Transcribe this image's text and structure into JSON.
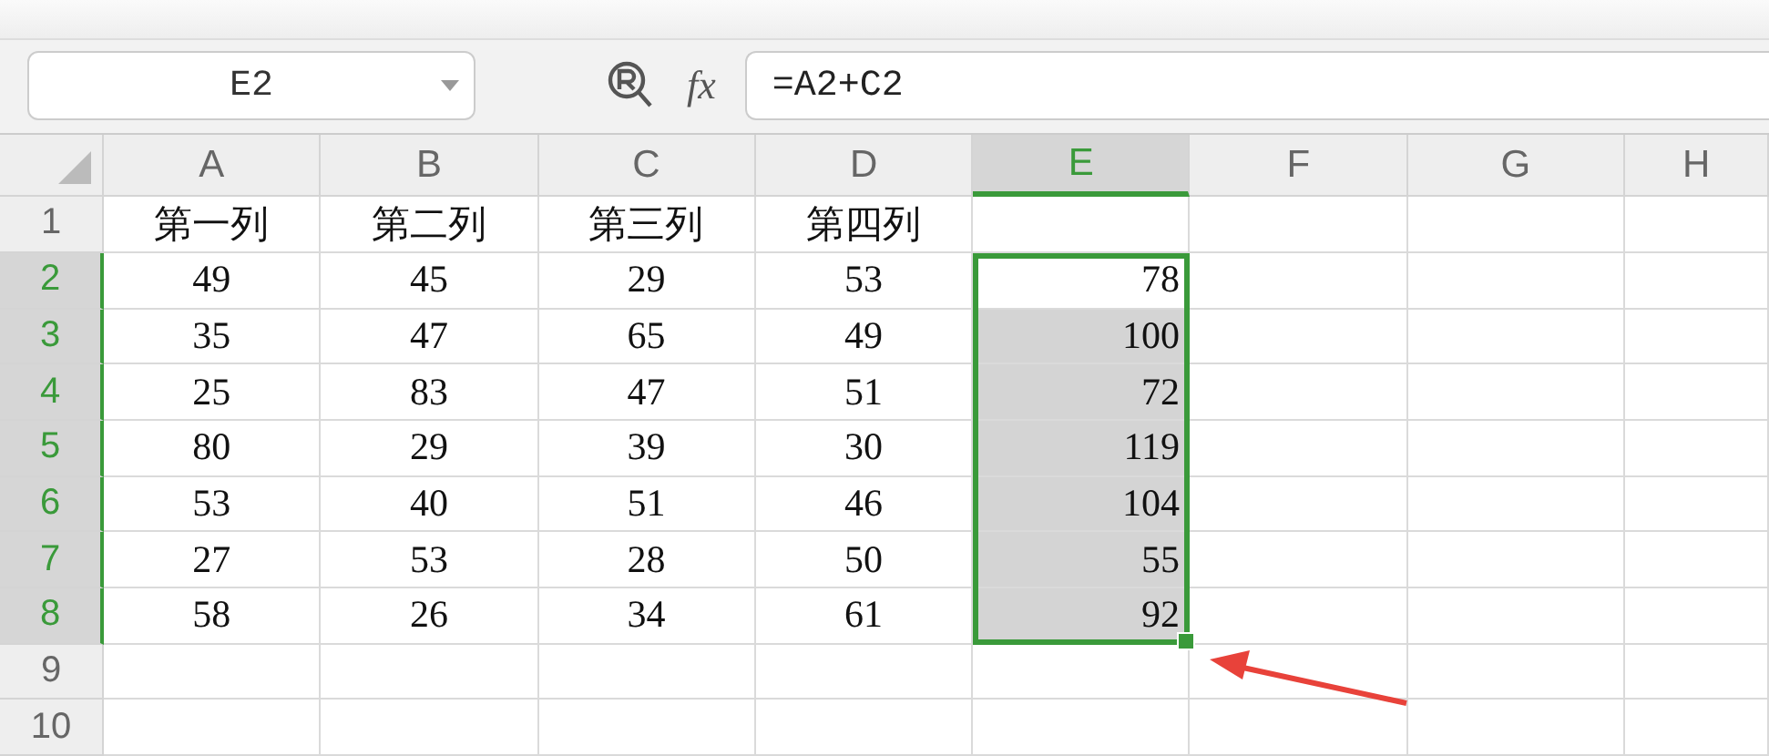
{
  "name_box": {
    "value": "E2"
  },
  "formula_bar": {
    "function_label": "fx",
    "value": "=A2+C2"
  },
  "columns": [
    {
      "label": "A",
      "selected": false
    },
    {
      "label": "B",
      "selected": false
    },
    {
      "label": "C",
      "selected": false
    },
    {
      "label": "D",
      "selected": false
    },
    {
      "label": "E",
      "selected": true
    },
    {
      "label": "F",
      "selected": false
    },
    {
      "label": "G",
      "selected": false
    },
    {
      "label": "H",
      "selected": false
    }
  ],
  "rows": [
    {
      "header": "1",
      "selected": false,
      "cells": [
        "第一列",
        "第二列",
        "第三列",
        "第四列"
      ]
    },
    {
      "header": "2",
      "selected": true,
      "cells": [
        "49",
        "45",
        "29",
        "53"
      ],
      "result": "78"
    },
    {
      "header": "3",
      "selected": true,
      "cells": [
        "35",
        "47",
        "65",
        "49"
      ],
      "result": "100"
    },
    {
      "header": "4",
      "selected": true,
      "cells": [
        "25",
        "83",
        "47",
        "51"
      ],
      "result": "72"
    },
    {
      "header": "5",
      "selected": true,
      "cells": [
        "80",
        "29",
        "39",
        "30"
      ],
      "result": "119"
    },
    {
      "header": "6",
      "selected": true,
      "cells": [
        "53",
        "40",
        "51",
        "46"
      ],
      "result": "104"
    },
    {
      "header": "7",
      "selected": true,
      "cells": [
        "27",
        "53",
        "28",
        "50"
      ],
      "result": "55"
    },
    {
      "header": "8",
      "selected": true,
      "cells": [
        "58",
        "26",
        "34",
        "61"
      ],
      "result": "92"
    },
    {
      "header": "9",
      "selected": false
    },
    {
      "header": "10",
      "selected": false
    }
  ]
}
